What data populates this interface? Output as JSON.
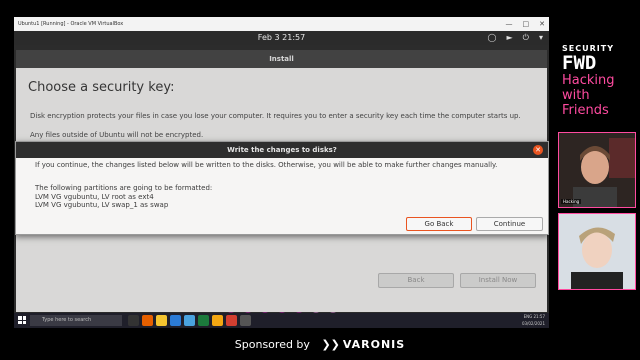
{
  "vbox": {
    "title": "Ubuntu1 [Running] - Oracle VM VirtualBox"
  },
  "ubuntu_panel": {
    "clock": "Feb 3  21:57"
  },
  "installer": {
    "header": "Install",
    "title": "Choose a security key:",
    "description": "Disk encryption protects your files in case you lose your computer. It requires you to enter a security key each time the computer starts up.",
    "note": "Any files outside of Ubuntu will not be encrypted.",
    "back_label": "Back",
    "install_now_label": "Install Now",
    "progress": {
      "filled": 5,
      "total": 7
    }
  },
  "dialog": {
    "title": "Write the changes to disks?",
    "body": "If you continue, the changes listed below will be written to the disks. Otherwise, you will be able to make further changes manually.",
    "formatted_heading": "The following partitions are going to be formatted:",
    "partitions": [
      "LVM VG vgubuntu, LV root as ext4",
      "LVM VG vgubuntu, LV swap_1 as swap"
    ],
    "go_back_label": "Go Back",
    "continue_label": "Continue"
  },
  "taskbar": {
    "search_placeholder": "Type here to search",
    "tray_time": "21:57",
    "tray_date": "03/02/2021",
    "tray_lang": "ENG"
  },
  "branding": {
    "security": "SECURITY",
    "fwd": "FWD",
    "tagline_1": "Hacking",
    "tagline_2": "with",
    "tagline_3": "Friends"
  },
  "cams": {
    "cam1_label": "Hacking"
  },
  "sponsor": {
    "prefix": "Sponsored by",
    "company": "VARONIS"
  },
  "colors": {
    "ubuntu_orange": "#e95420",
    "ubuntu_purple": "#77216f",
    "brand_pink": "#ff4ba0"
  }
}
